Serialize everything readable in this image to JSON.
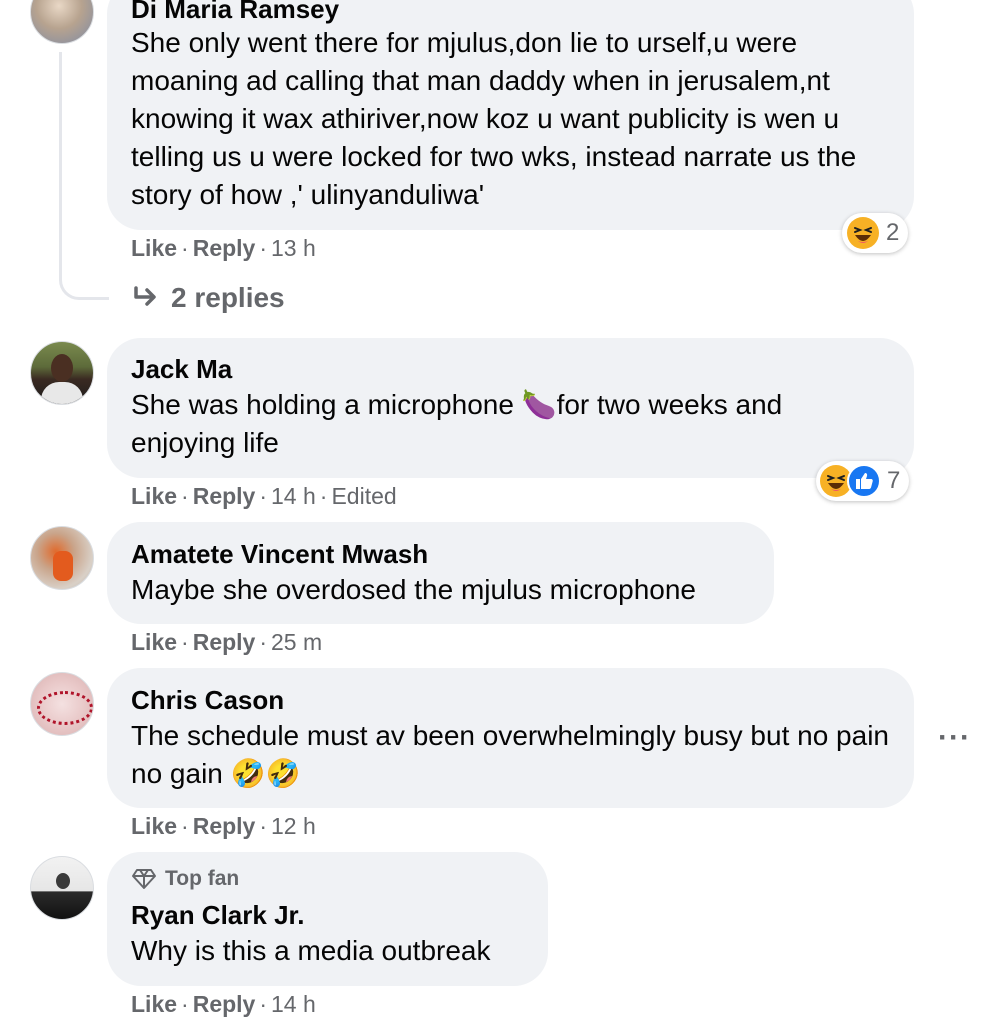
{
  "comments": [
    {
      "author": "Di Maria Ramsey",
      "text": "She only went there for mjulus,don lie to urself,u were moaning ad calling that man daddy when in jerusalem,nt knowing it wax athiriver,now koz u want publicity is wen u telling us u were locked for two wks, instead narrate us the story of how ,' ulinyanduliwa'",
      "like": "Like",
      "reply": "Reply",
      "time": "13 h",
      "reaction_count": "2",
      "reactions": [
        "haha-icon"
      ]
    },
    {
      "author": "Jack Ma",
      "text_before_emoji": "She was holding a microphone ",
      "emoji": "🍆",
      "text_after_emoji": "for two weeks and enjoying life",
      "like": "Like",
      "reply": "Reply",
      "time": "14 h",
      "edited": "Edited",
      "reaction_count": "7",
      "reactions": [
        "haha-icon",
        "like-icon"
      ]
    },
    {
      "author": "Amatete Vincent Mwash",
      "text": "Maybe she overdosed the mjulus microphone",
      "like": "Like",
      "reply": "Reply",
      "time": "25 m"
    },
    {
      "author": "Chris Cason",
      "text": "The schedule must av been overwhelmingly busy but no pain no gain",
      "emoji": "🤣🤣",
      "like": "Like",
      "reply": "Reply",
      "time": "12 h"
    },
    {
      "badge": "Top fan",
      "author": "Ryan Clark Jr.",
      "text": "Why is this a media outbreak",
      "like": "Like",
      "reply": "Reply",
      "time": "14 h"
    }
  ],
  "thread": {
    "replies_label": "2 replies"
  },
  "colors": {
    "bubble": "#f0f2f5",
    "meta_text": "#65676b",
    "like_blue": "#1877f2",
    "haha_yellow": "#f7b125"
  },
  "icons": {
    "reply_arrow": "reply-arrow-icon",
    "more": "more-options-icon",
    "top_fan": "diamond-icon"
  }
}
